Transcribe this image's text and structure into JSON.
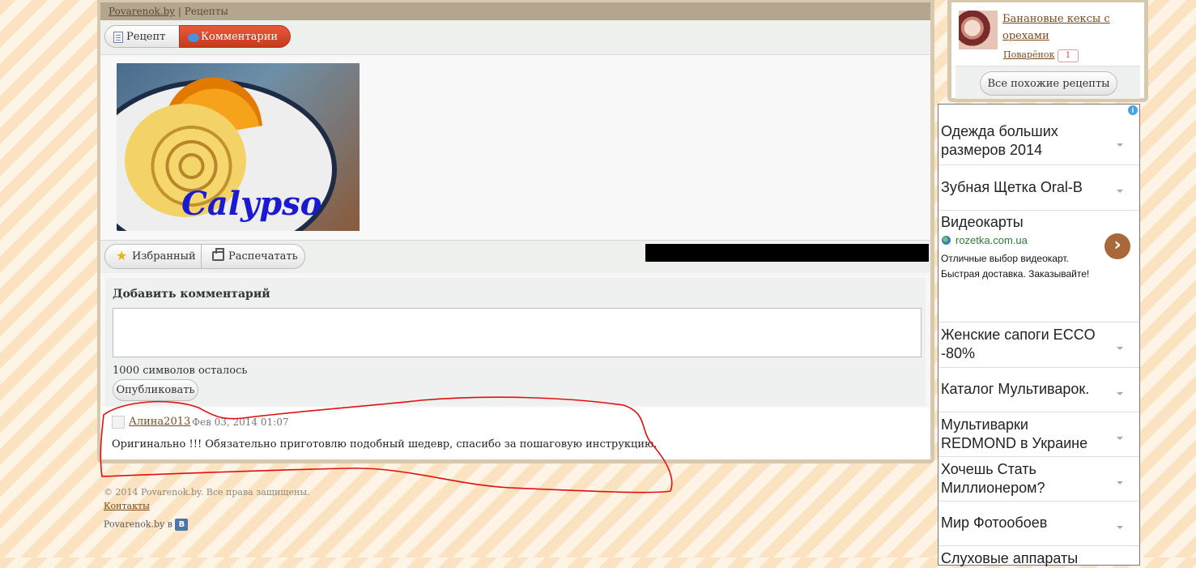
{
  "breadcrumb": {
    "site": "Povarenok.by",
    "separator": "|",
    "section": "Рецепты"
  },
  "tabs": {
    "recipe": "Рецепт",
    "comments": "Комментарии"
  },
  "recipe_image": {
    "watermark": "Calypso"
  },
  "actions": {
    "favorites": "Избранный",
    "print": "Распечатать"
  },
  "comment_form": {
    "title": "Добавить комментарий",
    "textarea_value": "",
    "chars_left": "1000 символов осталось",
    "publish": "Опубликовать"
  },
  "comment": {
    "author": "Алина2013",
    "date": "Фев 03, 2014 01:07",
    "text": "Оригинально !!! Обязательно приготовлю подобный шедевр, спасибо за пошаговую инструкцию."
  },
  "footer": {
    "copyright": "© 2014 Povarenok.by. Все права защищены.",
    "contacts": "Контакты",
    "vk_text": "Povarenok.by в",
    "vk_icon": "В"
  },
  "similar": {
    "title": "Банановые кексы с орехами",
    "source": "Поварёнок",
    "count": "1",
    "all_button": "Все похожие рецепты"
  },
  "ads": {
    "items": [
      {
        "text": "Одежда больших размеров 2014"
      },
      {
        "text": "Зубная Щетка Oral-B"
      },
      {
        "text": "Видеокарты",
        "domain": "rozetka.com.ua",
        "description": "Отличные выбор видеокарт. Быстрая доставка. Заказывайте!"
      },
      {
        "text": "Женские сапоги ECCO -80%"
      },
      {
        "text": "Каталог Мультиварок."
      },
      {
        "text": "Мультиварки REDMOND в Украине"
      },
      {
        "text": "Хочешь Стать Миллионером?"
      },
      {
        "text": "Мир Фотообоев"
      },
      {
        "text": "Слуховые аппараты"
      }
    ]
  },
  "colors": {
    "accent_tab": "#d9472a",
    "link": "#7a4a1a",
    "annotation": "#e01010",
    "ad_go": "#a9683a"
  },
  "icons": {
    "recipe_tab": "document-icon",
    "comments_tab": "speech-bubble-icon",
    "favorites": "star-icon",
    "print": "printer-icon",
    "avatar": "user-avatar-icon",
    "ad_info": "info-icon",
    "ad_domain": "globe-icon",
    "ad_go": "chevron-right-icon"
  }
}
